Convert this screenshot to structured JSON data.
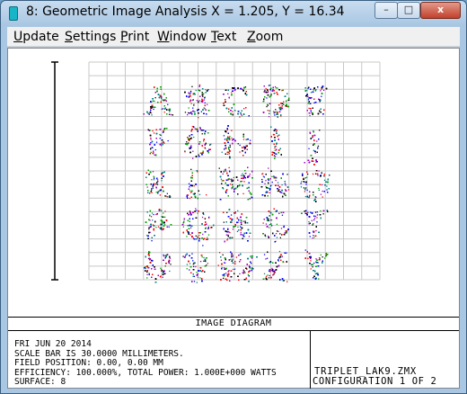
{
  "window": {
    "title": "8: Geometric Image Analysis X = 1.205, Y = 16.34",
    "app_icon": "zemax-window-icon",
    "controls": {
      "minimize": "–",
      "maximize": "□",
      "close": "x"
    }
  },
  "menu": {
    "items": [
      {
        "key": "U",
        "rest": "pdate"
      },
      {
        "key": "S",
        "rest": "ettings"
      },
      {
        "key": "P",
        "rest": "rint"
      },
      {
        "key": "W",
        "rest": "indow"
      },
      {
        "key": "T",
        "rest": "ext"
      },
      {
        "key": "Z",
        "rest": "oom"
      }
    ]
  },
  "plot": {
    "grid": true,
    "grid_divisions": 16,
    "spot_colors": [
      "#0000ff",
      "#00a000",
      "#ff0000",
      "#a000c0",
      "#008080",
      "#000000"
    ],
    "letter_rows": [
      "ABCDE",
      "FGHIJ",
      "KLMNO",
      "PQRST",
      "UVWXY"
    ]
  },
  "caption": {
    "text": "IMAGE DIAGRAM"
  },
  "info": {
    "lines": [
      "FRI JUN 20 2014",
      "SCALE BAR IS 30.0000 MILLIMETERS.",
      "FIELD POSITION: 0.00, 0.00 MM",
      "EFFICIENCY: 100.000%, TOTAL POWER: 1.000E+000 WATTS",
      "SURFACE: 8"
    ],
    "lens_file": "TRIPLET_LAK9.ZMX",
    "configuration": "CONFIGURATION 1 OF 2"
  }
}
